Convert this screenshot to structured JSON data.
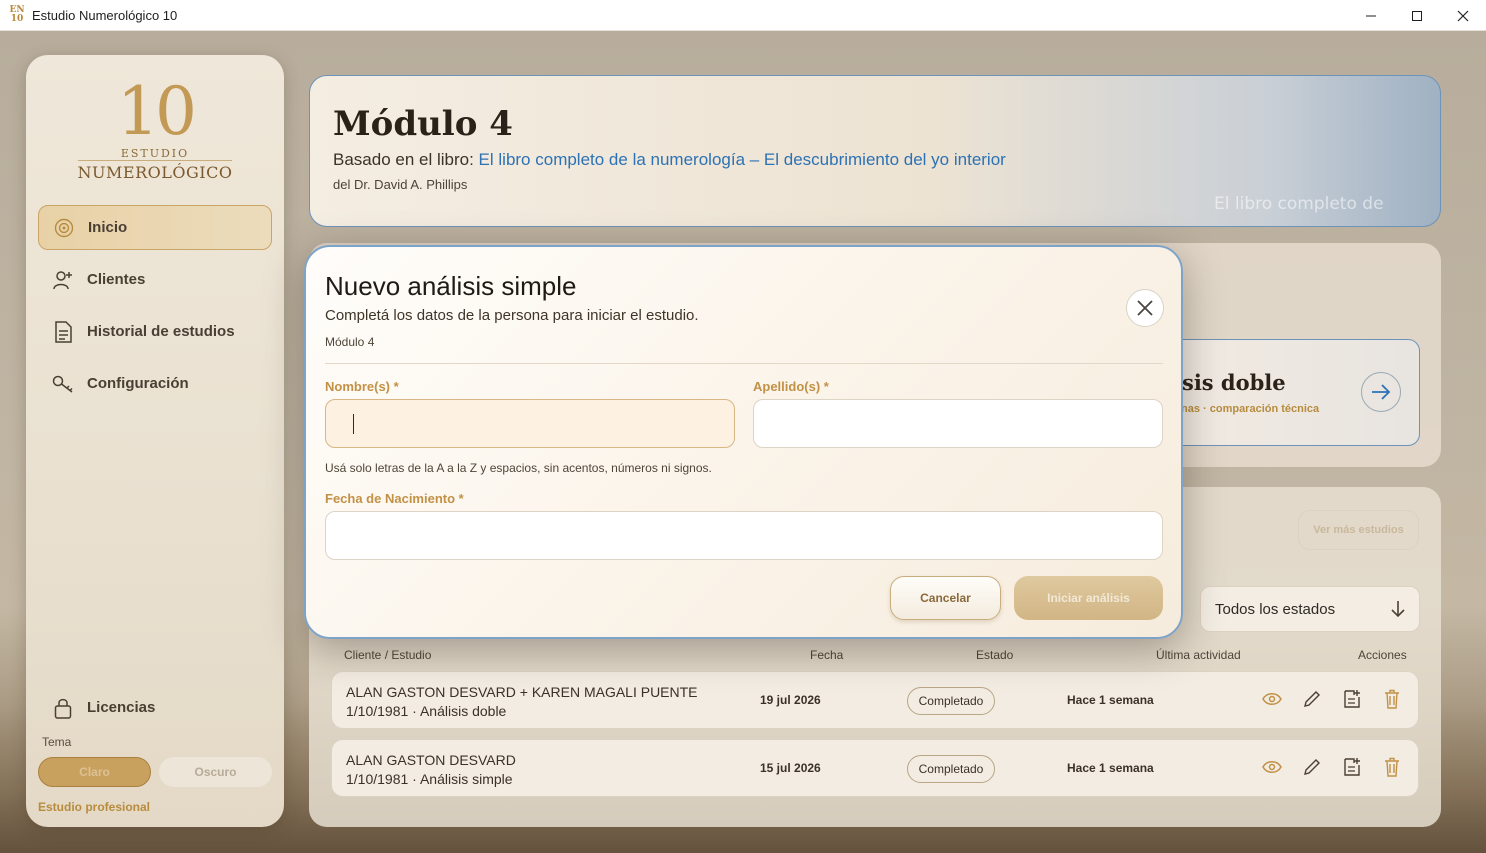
{
  "window": {
    "title": "Estudio Numerológico 10"
  },
  "sidebar": {
    "logo": {
      "number": "10",
      "line1": "ESTUDIO",
      "line2": "NUMEROLÓGICO"
    },
    "items": [
      {
        "label": "Inicio",
        "active": true
      },
      {
        "label": "Clientes"
      },
      {
        "label": "Historial de estudios"
      },
      {
        "label": "Configuración"
      }
    ],
    "licenses_label": "Licencias",
    "theme_label": "Tema",
    "theme_options": [
      "Claro",
      "Oscuro"
    ],
    "theme_selected": "Claro",
    "footer": "Estudio profesional"
  },
  "module": {
    "title": "Módulo 4",
    "book_prefix": "Basado en el libro: ",
    "book_title": "El libro completo de la numerología – El descubrimiento del yo interior",
    "author": "del Dr. David A. Phillips",
    "cover_text": "El libro completo de"
  },
  "double_analysis": {
    "title": "sis doble",
    "subtitle": "nas · comparación técnica"
  },
  "studies": {
    "more_label": "Ver más estudios",
    "status_filter": "Todos los estados",
    "columns": [
      "Cliente / Estudio",
      "Fecha",
      "Estado",
      "Última actividad",
      "Acciones"
    ],
    "rows": [
      {
        "client": "ALAN GASTON DESVARD + KAREN MAGALI PUENTE",
        "detail": "1/10/1981 · Análisis doble",
        "date": "19 jul 2026",
        "status": "Completado",
        "activity": "Hace 1 semana"
      },
      {
        "client": "ALAN GASTON DESVARD",
        "detail": "1/10/1981 · Análisis simple",
        "date": "15 jul 2026",
        "status": "Completado",
        "activity": "Hace 1 semana"
      }
    ]
  },
  "modal": {
    "title": "Nuevo análisis simple",
    "subtitle": "Completá los datos de la persona para iniciar el estudio.",
    "module": "Módulo 4",
    "first_name_label": "Nombre(s) *",
    "first_name_value": "",
    "last_name_label": "Apellido(s) *",
    "last_name_value": "",
    "hint": "Usá solo letras de la A a la Z y espacios, sin acentos, números ni signos.",
    "birth_label": "Fecha de Nacimiento *",
    "birth_value": "",
    "cancel_label": "Cancelar",
    "start_label": "Iniciar análisis"
  },
  "colors": {
    "accent_gold": "#c29146",
    "link_blue": "#2c72b5",
    "modal_border": "#7ea3c8"
  }
}
